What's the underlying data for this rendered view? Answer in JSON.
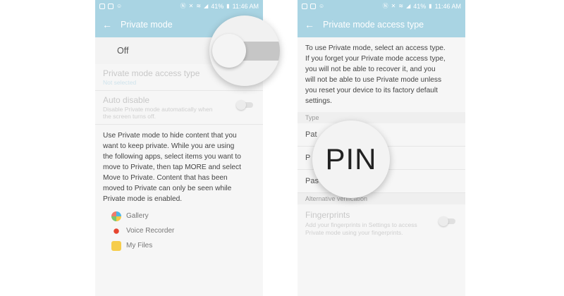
{
  "left": {
    "status": {
      "signal": "41%",
      "time": "11:46 AM"
    },
    "appbar": {
      "title": "Private mode"
    },
    "toggle_label": "Off",
    "access_type": {
      "title": "Private mode access type",
      "sub": "Not selected"
    },
    "auto_disable": {
      "title": "Auto disable",
      "sub": "Disable Private mode automatically when the screen turns off."
    },
    "description_lines": [
      "Use Private mode to hide content that you",
      "want to keep private. While you are using",
      "the following apps, select items you want to",
      "move to Private, then tap MORE and select",
      "Move to Private. Content that has been",
      "moved to Private can only be seen while",
      "Private mode is enabled."
    ],
    "apps": [
      "Gallery",
      "Voice Recorder",
      "My Files"
    ]
  },
  "right": {
    "status": {
      "signal": "41%",
      "time": "11:46 AM"
    },
    "appbar": {
      "title": "Private mode access type"
    },
    "intro_lines": [
      "To use Private mode, select an access type.",
      "If you forget your Private mode access type,",
      "you will not be able to recover it, and you",
      "will not be able to use Private mode unless",
      "you reset your device to its factory default",
      "settings."
    ],
    "type_header": "Type",
    "types": [
      "Pat",
      "P",
      "Pas"
    ],
    "alt_header": "Alternative verification",
    "fingerprints": {
      "title": "Fingerprints",
      "sub": "Add your fingerprints in Settings to access Private mode using your fingerprints."
    },
    "magnified_label": "PIN"
  }
}
